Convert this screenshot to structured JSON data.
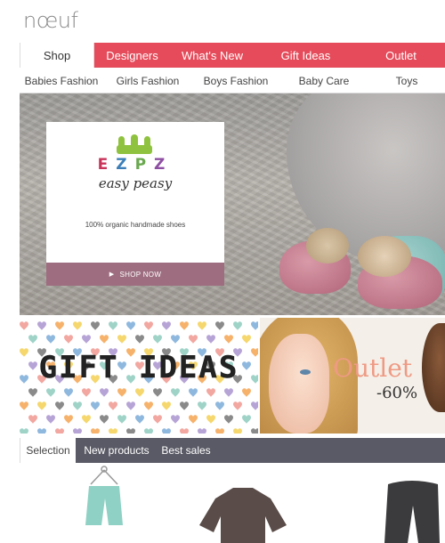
{
  "logo": {
    "text": "nœuf"
  },
  "mainnav": {
    "items": [
      {
        "label": "Shop",
        "active": true
      },
      {
        "label": "Designers"
      },
      {
        "label": "What's New"
      },
      {
        "label": "Gift Ideas"
      },
      {
        "label": "Outlet"
      }
    ]
  },
  "subnav": {
    "items": [
      {
        "label": "Babies Fashion"
      },
      {
        "label": "Girls Fashion"
      },
      {
        "label": "Boys Fashion"
      },
      {
        "label": "Baby Care"
      },
      {
        "label": "Toys"
      }
    ]
  },
  "hero": {
    "brand_letters": [
      "E",
      "Z",
      "P",
      "Z"
    ],
    "brand_script": "easy peasy",
    "tagline": "100% organic handmade shoes",
    "cta": "SHOP NOW",
    "cta_icon": "play-arrow-icon"
  },
  "banners": {
    "gift": {
      "title": "GIFT IDEAS"
    },
    "outlet": {
      "title": "Outlet",
      "discount": "-60%"
    }
  },
  "product_tabs": {
    "items": [
      {
        "label": "Selection",
        "active": true
      },
      {
        "label": "New products"
      },
      {
        "label": "Best sales"
      }
    ]
  },
  "colors": {
    "nav_accent": "#e54b5a",
    "cta": "#9e6e80",
    "tabs_bar": "#5a5a66",
    "outlet_text": "#ef9a84"
  }
}
